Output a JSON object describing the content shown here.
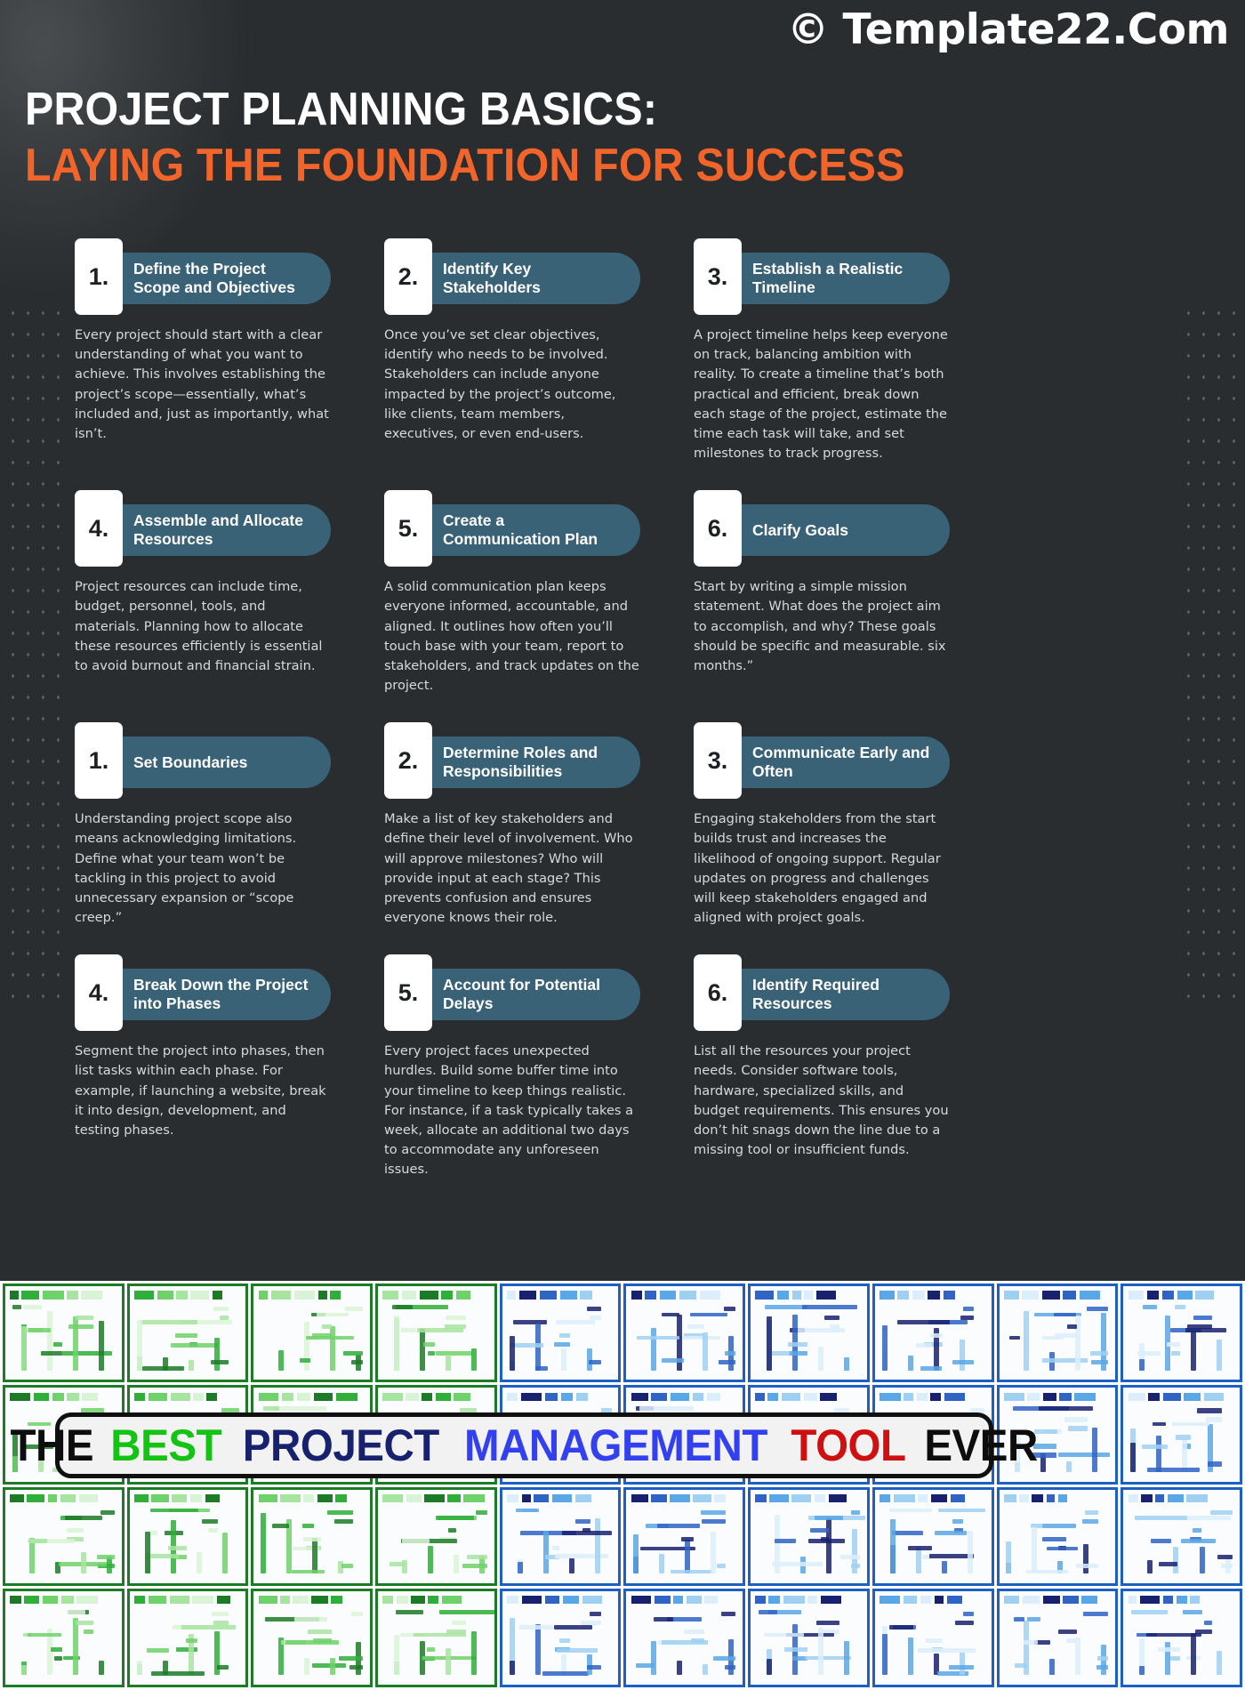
{
  "watermark": "© Template22.Com",
  "title": {
    "line1": "PROJECT PLANNING BASICS:",
    "line2": "LAYING THE FOUNDATION FOR SUCCESS",
    "accent_color": "#f2652a",
    "line1_color": "#ffffff"
  },
  "theme": {
    "background": "#292d30",
    "card_header": "#3a6277",
    "number_chip": "#ffffff",
    "body_text": "#d6dadc"
  },
  "cards": [
    {
      "number": "1.",
      "title": "Define the Project Scope and Objectives",
      "body": "Every project should start with a clear understanding of what you want to achieve. This involves establishing the project’s scope—essentially, what’s included and, just as importantly, what isn’t."
    },
    {
      "number": "2.",
      "title": "Identify Key Stakeholders",
      "body": "Once you’ve set clear objectives, identify who needs to be involved. Stakeholders can include anyone impacted by the project’s outcome, like clients, team members, executives, or even end-users."
    },
    {
      "number": "3.",
      "title": "Establish a Realistic Timeline",
      "body": "A project timeline helps keep everyone on track, balancing ambition with reality. To create a timeline that’s both practical and efficient, break down each stage of the project, estimate the time each task will take, and set milestones to track progress."
    },
    {
      "number": "4.",
      "title": "Assemble and Allocate Resources",
      "body": "Project resources can include time, budget, personnel, tools, and materials. Planning how to allocate these resources efficiently is essential to avoid burnout and financial strain."
    },
    {
      "number": "5.",
      "title": "Create a Communication Plan",
      "body": "A solid communication plan keeps everyone informed, accountable, and aligned. It outlines how often you’ll touch base with your team, report to stakeholders, and track updates on the project."
    },
    {
      "number": "6.",
      "title": "Clarify Goals",
      "body": "Start by writing a simple mission statement. What does the project aim to accomplish, and why? These goals should be specific and measurable. six months.”"
    },
    {
      "number": "1.",
      "title": "Set Boundaries",
      "body": "Understanding project scope also means acknowledging limitations. Define what your team won’t be tackling in this project to avoid unnecessary expansion or “scope creep.”"
    },
    {
      "number": "2.",
      "title": "Determine Roles and Responsibilities",
      "body": "Make a list of key stakeholders and define their level of involvement. Who will approve milestones? Who will provide input at each stage? This prevents confusion and ensures everyone knows their role."
    },
    {
      "number": "3.",
      "title": "Communicate Early and Often",
      "body": "Engaging stakeholders from the start builds trust and increases the likelihood of ongoing support. Regular updates on progress and challenges will keep stakeholders engaged and aligned with project goals."
    },
    {
      "number": "4.",
      "title": "Break Down the Project into Phases",
      "body": "Segment the project into phases, then list tasks within each phase. For example, if launching a website, break it into design, development, and testing phases."
    },
    {
      "number": "5.",
      "title": "Account for Potential Delays",
      "body": "Every project faces unexpected hurdles. Build some buffer time into your timeline to keep things realistic. For instance, if a task typically takes a week, allocate an additional two days to accommodate any unforeseen issues."
    },
    {
      "number": "6.",
      "title": "Identify Required Resources",
      "body": "List all the resources your project needs. Consider software tools, hardware, specialized skills, and budget requirements. This ensures you don’t hit snags down the line due to a missing tool or insufficient funds."
    }
  ],
  "promo": {
    "banner_words": [
      {
        "text": "THE",
        "color": "#0d0d0d"
      },
      {
        "text": "BEST",
        "color": "#13c413"
      },
      {
        "text": "PROJECT",
        "color": "#17216e"
      },
      {
        "text": "MANAGEMENT",
        "color": "#3240ef"
      },
      {
        "text": "TOOL",
        "color": "#d01010"
      },
      {
        "text": "EVER",
        "color": "#0d0d0d"
      }
    ],
    "tile_theme_left": "green",
    "tile_theme_right": "blue"
  }
}
